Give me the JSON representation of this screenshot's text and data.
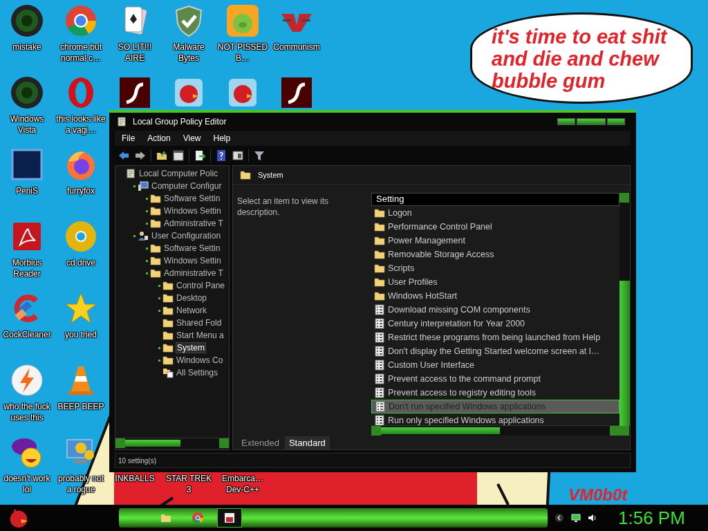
{
  "desktop_rows": [
    [
      {
        "label": "mistake",
        "kind": "orb"
      },
      {
        "label": "chrome but normal c…",
        "kind": "chrome"
      },
      {
        "label": "SO LIT!!! AIRE",
        "kind": "cards"
      },
      {
        "label": "Malware Bytes",
        "kind": "shield"
      },
      {
        "label": "NOT PISSED B…",
        "kind": "pig"
      },
      {
        "label": "Communism",
        "kind": "emblem"
      }
    ],
    [
      {
        "label": "Windows Vista",
        "kind": "orb"
      },
      {
        "label": "this looks like a vagi…",
        "kind": "ring"
      },
      {
        "kind": "flash"
      },
      {
        "kind": "bird"
      },
      {
        "kind": "bird"
      },
      {
        "kind": "flash"
      }
    ],
    [
      {
        "label": "PeniS",
        "kind": "tile"
      },
      {
        "label": "furryfox",
        "kind": "fox"
      }
    ],
    [
      {
        "label": "Morbius Reader",
        "kind": "pdf"
      },
      {
        "label": "cd drive",
        "kind": "disc"
      }
    ],
    [
      {
        "label": "CockCleaner",
        "kind": "cleaner"
      },
      {
        "label": "you tried",
        "kind": "star"
      }
    ],
    [
      {
        "label": "who the fuck uses this",
        "kind": "bolt"
      },
      {
        "label": "BEEP BEEP",
        "kind": "cone"
      }
    ],
    [
      {
        "label": "doesn't work lol",
        "kind": "smiley"
      },
      {
        "label": "probably not a rogue",
        "kind": "gears"
      },
      {
        "label": "INKBALLS"
      },
      {
        "label": "STAR TREK 3"
      },
      {
        "label": "Embarca… Dev-C++"
      }
    ]
  ],
  "speech_bubble": "it's time to eat shit and die and chew bubble gum",
  "wallpaper_text": "VM0b0t",
  "window": {
    "title": "Local Group Policy Editor",
    "menu": [
      "File",
      "Action",
      "View",
      "Help"
    ],
    "tree": [
      {
        "label": "Local Computer Polic",
        "kind": "policy",
        "bullet": false,
        "selected": false,
        "children": [
          {
            "label": "Computer Configur",
            "kind": "computer",
            "bullet": true,
            "selected": false,
            "children": [
              {
                "label": "Software Settin",
                "kind": "folder",
                "bullet": true,
                "selected": false
              },
              {
                "label": "Windows Settin",
                "kind": "folder",
                "bullet": true,
                "selected": false
              },
              {
                "label": "Administrative T",
                "kind": "folder",
                "bullet": true,
                "selected": false
              }
            ]
          },
          {
            "label": "User Configuration",
            "kind": "user",
            "bullet": true,
            "selected": false,
            "children": [
              {
                "label": "Software Settin",
                "kind": "folder",
                "bullet": true,
                "selected": false
              },
              {
                "label": "Windows Settin",
                "kind": "folder",
                "bullet": true,
                "selected": false
              },
              {
                "label": "Administrative T",
                "kind": "folder",
                "bullet": true,
                "selected": false,
                "children": [
                  {
                    "label": "Control Pane",
                    "kind": "folder",
                    "bullet": true,
                    "selected": false
                  },
                  {
                    "label": "Desktop",
                    "kind": "folder",
                    "bullet": true,
                    "selected": false
                  },
                  {
                    "label": "Network",
                    "kind": "folder",
                    "bullet": true,
                    "selected": false
                  },
                  {
                    "label": "Shared Fold",
                    "kind": "folder",
                    "bullet": false,
                    "selected": false
                  },
                  {
                    "label": "Start Menu a",
                    "kind": "folder",
                    "bullet": false,
                    "selected": false
                  },
                  {
                    "label": "System",
                    "kind": "folder",
                    "bullet": true,
                    "selected": true
                  },
                  {
                    "label": "Windows Co",
                    "kind": "folder",
                    "bullet": true,
                    "selected": false
                  },
                  {
                    "label": "All Settings",
                    "kind": "all",
                    "bullet": false,
                    "selected": false
                  }
                ]
              }
            ]
          }
        ]
      }
    ],
    "heading": "System",
    "description": "Select an item to view its description.",
    "column": "Setting",
    "items": [
      {
        "label": "Logon",
        "kind": "folder",
        "selected": false
      },
      {
        "label": "Performance Control Panel",
        "kind": "folder",
        "selected": false
      },
      {
        "label": "Power Management",
        "kind": "folder",
        "selected": false
      },
      {
        "label": "Removable Storage Access",
        "kind": "folder",
        "selected": false
      },
      {
        "label": "Scripts",
        "kind": "folder",
        "selected": false
      },
      {
        "label": "User Profiles",
        "kind": "folder",
        "selected": false
      },
      {
        "label": "Windows HotStart",
        "kind": "folder",
        "selected": false
      },
      {
        "label": "Download missing COM components",
        "kind": "setting",
        "selected": false
      },
      {
        "label": "Century interpretation for Year 2000",
        "kind": "setting",
        "selected": false
      },
      {
        "label": "Restrict these programs from being launched from Help",
        "kind": "setting",
        "selected": false
      },
      {
        "label": "Don't display the Getting Started welcome screen at l…",
        "kind": "setting",
        "selected": false
      },
      {
        "label": "Custom User Interface",
        "kind": "setting",
        "selected": false
      },
      {
        "label": "Prevent access to the command prompt",
        "kind": "setting",
        "selected": false
      },
      {
        "label": "Prevent access to registry editing tools",
        "kind": "setting",
        "selected": false
      },
      {
        "label": "Don't run specified Windows applications",
        "kind": "setting",
        "selected": true
      },
      {
        "label": "Run only specified Windows applications",
        "kind": "setting",
        "selected": false
      }
    ],
    "tabs": [
      {
        "label": "Extended",
        "selected": false
      },
      {
        "label": "Standard",
        "selected": true
      }
    ],
    "status": "10 setting(s)"
  },
  "taskbar": {
    "apps": [
      {
        "kind": "folder",
        "active": false
      },
      {
        "kind": "chrome",
        "active": false
      },
      {
        "kind": "editor",
        "active": true
      }
    ],
    "clock": "1:56 PM"
  }
}
